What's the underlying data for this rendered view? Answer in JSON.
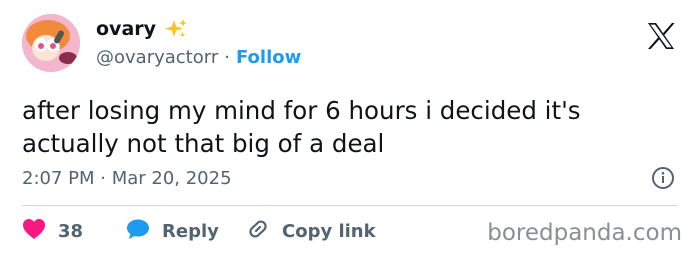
{
  "author": {
    "display_name": "ovary",
    "handle": "@ovaryactorr",
    "separator": "·",
    "follow_label": "Follow",
    "badge_icon": "sparkles-emoji"
  },
  "tweet": {
    "text": "after losing my mind for 6 hours i decided it's actually not that big of a deal",
    "timestamp": "2:07 PM · Mar 20, 2025"
  },
  "actions": {
    "like_count": "38",
    "reply_label": "Reply",
    "copy_label": "Copy link"
  },
  "branding": {
    "platform_icon": "x-logo",
    "watermark": "boredpanda.com"
  },
  "colors": {
    "link_blue": "#1d9bf0",
    "heart_pink": "#f91880",
    "muted_text": "#536471"
  }
}
